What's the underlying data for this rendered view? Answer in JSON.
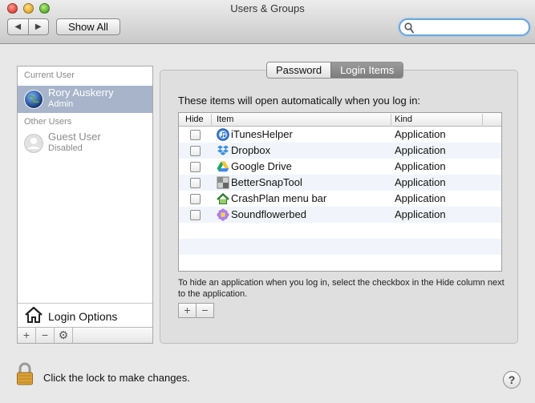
{
  "window": {
    "title": "Users & Groups"
  },
  "toolbar": {
    "back_glyph": "◀",
    "forward_glyph": "▶",
    "show_all_label": "Show All",
    "search_placeholder": ""
  },
  "sidebar": {
    "current_user_header": "Current User",
    "current_user": {
      "name": "Rory Auskerry",
      "role": "Admin",
      "icon": "globe-avatar-icon"
    },
    "other_users_header": "Other Users",
    "guest_user": {
      "name": "Guest User",
      "role": "Disabled",
      "icon": "guest-silhouette-icon"
    },
    "login_options_label": "Login Options",
    "buttons": {
      "add": "+",
      "remove": "−",
      "gear": "⚙"
    }
  },
  "tabs": [
    {
      "label": "Password",
      "active": false
    },
    {
      "label": "Login Items",
      "active": true
    }
  ],
  "login_items": {
    "intro": "These items will open automatically when you log in:",
    "columns": {
      "hide": "Hide",
      "item": "Item",
      "kind": "Kind"
    },
    "rows": [
      {
        "name": "iTunesHelper",
        "kind": "Application",
        "hidden": false,
        "icon": "itunes-icon"
      },
      {
        "name": "Dropbox",
        "kind": "Application",
        "hidden": false,
        "icon": "dropbox-icon"
      },
      {
        "name": "Google Drive",
        "kind": "Application",
        "hidden": false,
        "icon": "google-drive-icon"
      },
      {
        "name": "BetterSnapTool",
        "kind": "Application",
        "hidden": false,
        "icon": "bettersnaptool-icon"
      },
      {
        "name": "CrashPlan menu bar",
        "kind": "Application",
        "hidden": false,
        "icon": "crashplan-icon"
      },
      {
        "name": "Soundflowerbed",
        "kind": "Application",
        "hidden": false,
        "icon": "soundflowerbed-icon"
      }
    ],
    "hint": "To hide an application when you log in, select the checkbox in the Hide column next to the application.",
    "add": "+",
    "remove": "−"
  },
  "footer": {
    "lock_text": "Click the lock to make changes.",
    "help": "?"
  },
  "colors": {
    "selection": "#a7b4ca",
    "search_focus": "#6aa7e0",
    "active_tab": "#8a8a8a"
  }
}
